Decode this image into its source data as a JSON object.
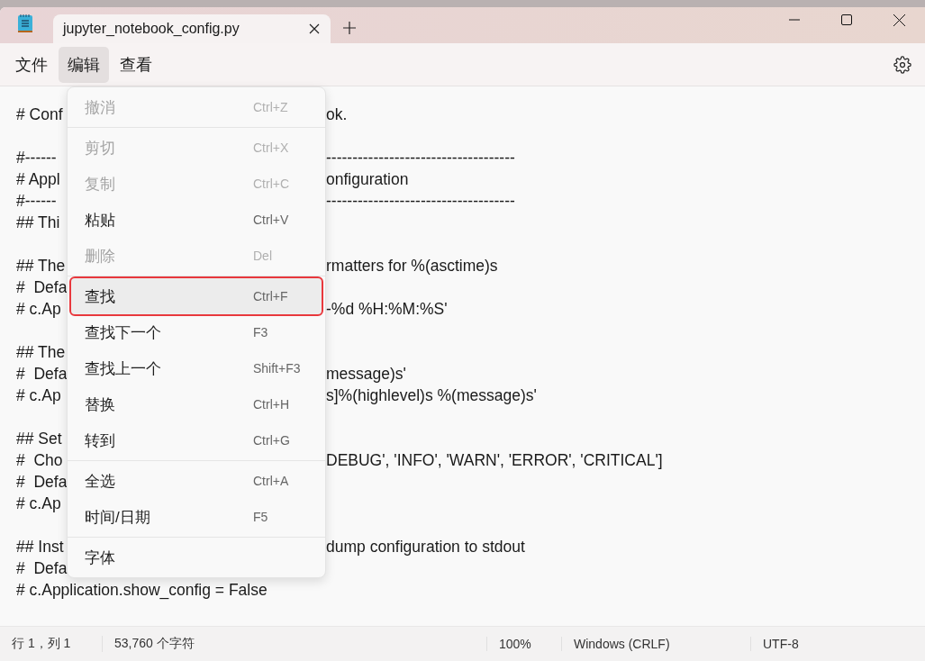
{
  "tabs": [
    {
      "label": "jupyter_notebook_config.py",
      "selected": true
    }
  ],
  "menubar": [
    {
      "label": "文件",
      "selected": false
    },
    {
      "label": "编辑",
      "selected": true
    },
    {
      "label": "查看",
      "selected": false
    }
  ],
  "editor_lines": [
    {
      "kind": "split",
      "left": "# Conf",
      "right": "ok."
    },
    {
      "kind": "blank"
    },
    {
      "kind": "split",
      "left": "#------",
      "right": "------------------------------------"
    },
    {
      "kind": "split",
      "left": "# Appl",
      "right": "onfiguration"
    },
    {
      "kind": "split",
      "left": "#------",
      "right": "------------------------------------"
    },
    {
      "kind": "split",
      "left": "## Thi"
    },
    {
      "kind": "blank"
    },
    {
      "kind": "split",
      "left": "## The",
      "right": "rmatters for %(asctime)s"
    },
    {
      "kind": "split",
      "left": "#  Defa"
    },
    {
      "kind": "split",
      "left": "# c.Ap",
      "right": "-%d %H:%M:%S'"
    },
    {
      "kind": "blank"
    },
    {
      "kind": "split",
      "left": "## The"
    },
    {
      "kind": "split",
      "left": "#  Defa",
      "right": "message)s'"
    },
    {
      "kind": "split",
      "left": "# c.Ap",
      "right": "s]%(highlevel)s %(message)s'"
    },
    {
      "kind": "blank"
    },
    {
      "kind": "split",
      "left": "## Set"
    },
    {
      "kind": "split",
      "left": "#  Cho",
      "right": "DEBUG', 'INFO', 'WARN', 'ERROR', 'CRITICAL']"
    },
    {
      "kind": "split",
      "left": "#  Defa"
    },
    {
      "kind": "split",
      "left": "# c.Ap"
    },
    {
      "kind": "blank"
    },
    {
      "kind": "split",
      "left": "## Inst",
      "right": "dump configuration to stdout"
    },
    {
      "kind": "split",
      "left": "#  Defa"
    },
    {
      "kind": "full",
      "left": "# c.Application.show_config = False"
    }
  ],
  "edit_menu": {
    "groups": [
      [
        {
          "label": "撤消",
          "shortcut": "Ctrl+Z",
          "disabled": true,
          "selected": false
        }
      ],
      [
        {
          "label": "剪切",
          "shortcut": "Ctrl+X",
          "disabled": true,
          "selected": false
        },
        {
          "label": "复制",
          "shortcut": "Ctrl+C",
          "disabled": true,
          "selected": false
        },
        {
          "label": "粘贴",
          "shortcut": "Ctrl+V",
          "disabled": false,
          "selected": false
        },
        {
          "label": "删除",
          "shortcut": "Del",
          "disabled": true,
          "selected": false
        }
      ],
      [
        {
          "label": "查找",
          "shortcut": "Ctrl+F",
          "disabled": false,
          "selected": true
        },
        {
          "label": "查找下一个",
          "shortcut": "F3",
          "disabled": false,
          "selected": false
        },
        {
          "label": "查找上一个",
          "shortcut": "Shift+F3",
          "disabled": false,
          "selected": false
        },
        {
          "label": "替换",
          "shortcut": "Ctrl+H",
          "disabled": false,
          "selected": false
        },
        {
          "label": "转到",
          "shortcut": "Ctrl+G",
          "disabled": false,
          "selected": false
        }
      ],
      [
        {
          "label": "全选",
          "shortcut": "Ctrl+A",
          "disabled": false,
          "selected": false
        },
        {
          "label": "时间/日期",
          "shortcut": "F5",
          "disabled": false,
          "selected": false
        }
      ],
      [
        {
          "label": "字体",
          "disabled": false,
          "selected": false
        }
      ]
    ]
  },
  "status_bar": [
    "行 1，列 1",
    "53,760 个字符",
    "100%",
    "Windows (CRLF)",
    "UTF-8"
  ]
}
